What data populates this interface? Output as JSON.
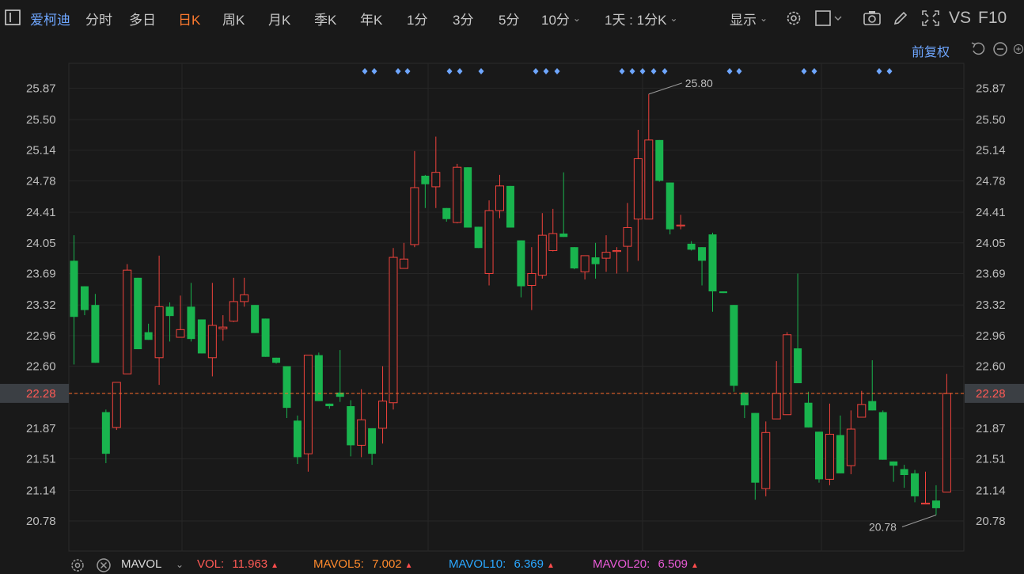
{
  "toolbar": {
    "stock_name": "爱柯迪",
    "periods": [
      "分时",
      "多日",
      "日K",
      "周K",
      "月K",
      "季K",
      "年K",
      "1分",
      "3分",
      "5分",
      "10分"
    ],
    "active_period": "日K",
    "interval_select": "1天 : 1分K",
    "display_label": "显示",
    "vs_label": "VS",
    "f10_label": "F10"
  },
  "adjust_label": "前复权",
  "axis": {
    "ticks": [
      "25.87",
      "25.50",
      "25.14",
      "24.78",
      "24.41",
      "24.05",
      "23.69",
      "23.32",
      "22.96",
      "22.60",
      "22.28",
      "21.87",
      "21.51",
      "21.14",
      "20.78"
    ],
    "current_price": "22.28"
  },
  "annotations": {
    "high": "25.80",
    "low": "20.78"
  },
  "volume": {
    "indicator": "MAVOL",
    "vol_label": "VOL:",
    "vol_value": "11.963",
    "mavol5_label": "MAVOL5:",
    "mavol5_value": "7.002",
    "mavol10_label": "MAVOL10:",
    "mavol10_value": "6.369",
    "mavol20_label": "MAVOL20:",
    "mavol20_value": "6.509"
  },
  "colors": {
    "up": "#f0423c",
    "down": "#19b44e",
    "accent": "#6ea6ff",
    "active": "#ff7a2e",
    "mavol5": "#ff8a2c",
    "mavol10": "#2aa7ff",
    "mavol20": "#e85ad6"
  },
  "chart_data": {
    "type": "candlestick",
    "ylim": [
      20.6,
      26.2
    ],
    "candles": [
      [
        23.84,
        23.18,
        24.14,
        22.62
      ],
      [
        23.54,
        23.26,
        23.54,
        23.2
      ],
      [
        23.32,
        22.64,
        23.45,
        22.64
      ],
      [
        22.06,
        21.57,
        22.09,
        21.46
      ],
      [
        21.88,
        22.41,
        22.41,
        21.85
      ],
      [
        22.51,
        23.73,
        23.8,
        22.51
      ],
      [
        23.64,
        22.8,
        23.64,
        22.8
      ],
      [
        23.0,
        22.91,
        23.1,
        22.91
      ],
      [
        22.7,
        23.3,
        23.9,
        22.38
      ],
      [
        23.3,
        23.19,
        23.35,
        22.89
      ],
      [
        22.94,
        23.03,
        23.43,
        22.94
      ],
      [
        23.3,
        22.92,
        23.58,
        22.89
      ],
      [
        23.15,
        22.75,
        23.15,
        22.75
      ],
      [
        22.7,
        23.08,
        23.58,
        22.48
      ],
      [
        23.04,
        23.06,
        23.2,
        22.9
      ],
      [
        23.13,
        23.36,
        23.64,
        23.12
      ],
      [
        23.36,
        23.44,
        23.64,
        23.3
      ],
      [
        23.32,
        22.99,
        23.32,
        22.99
      ],
      [
        23.16,
        22.71,
        23.16,
        22.71
      ],
      [
        22.7,
        22.64,
        22.7,
        22.63
      ],
      [
        22.6,
        22.11,
        22.6,
        21.99
      ],
      [
        21.96,
        21.53,
        22.02,
        21.45
      ],
      [
        21.57,
        22.73,
        22.73,
        21.36
      ],
      [
        22.73,
        22.19,
        22.76,
        22.19
      ],
      [
        22.16,
        22.13,
        22.16,
        22.1
      ],
      [
        22.29,
        22.24,
        22.79,
        22.18
      ],
      [
        22.13,
        21.67,
        22.2,
        21.54
      ],
      [
        21.67,
        21.97,
        22.33,
        21.53
      ],
      [
        21.87,
        21.57,
        21.87,
        21.44
      ],
      [
        21.87,
        22.19,
        22.6,
        21.69
      ],
      [
        22.17,
        23.88,
        23.99,
        22.09
      ],
      [
        23.75,
        23.86,
        24.05,
        23.75
      ],
      [
        24.03,
        24.7,
        25.13,
        24.0
      ],
      [
        24.84,
        24.74,
        24.85,
        24.46
      ],
      [
        24.71,
        24.88,
        25.3,
        24.46
      ],
      [
        24.46,
        24.33,
        24.46,
        24.3
      ],
      [
        24.29,
        24.94,
        24.98,
        24.28
      ],
      [
        24.94,
        24.23,
        24.94,
        24.23
      ],
      [
        24.24,
        23.99,
        24.24,
        23.99
      ],
      [
        23.69,
        24.43,
        24.55,
        23.55
      ],
      [
        24.43,
        24.72,
        24.85,
        24.34
      ],
      [
        24.72,
        24.23,
        24.72,
        24.23
      ],
      [
        24.08,
        23.54,
        24.08,
        23.41
      ],
      [
        23.55,
        23.69,
        24.0,
        23.26
      ],
      [
        23.67,
        24.14,
        24.4,
        23.63
      ],
      [
        23.96,
        24.16,
        24.45,
        23.95
      ],
      [
        24.16,
        24.12,
        24.88,
        24.12
      ],
      [
        24.0,
        23.75,
        24.0,
        23.74
      ],
      [
        23.71,
        23.9,
        23.9,
        23.62
      ],
      [
        23.88,
        23.8,
        24.05,
        23.63
      ],
      [
        23.87,
        23.94,
        24.14,
        23.71
      ],
      [
        23.96,
        23.96,
        24.0,
        23.69
      ],
      [
        24.01,
        24.23,
        24.52,
        23.71
      ],
      [
        24.33,
        25.04,
        25.38,
        23.84
      ],
      [
        24.33,
        25.26,
        25.8,
        24.33
      ],
      [
        25.26,
        24.78,
        25.26,
        24.77
      ],
      [
        24.76,
        24.21,
        24.76,
        24.15
      ],
      [
        24.26,
        24.26,
        24.38,
        24.21
      ],
      [
        24.04,
        23.97,
        24.07,
        23.96
      ],
      [
        24.0,
        23.84,
        24.0,
        23.55
      ],
      [
        24.15,
        23.48,
        24.17,
        23.24
      ],
      [
        23.48,
        23.46,
        23.48,
        23.46
      ],
      [
        23.32,
        22.37,
        23.32,
        22.3
      ],
      [
        22.29,
        22.14,
        22.29,
        21.99
      ],
      [
        22.05,
        21.23,
        22.05,
        21.03
      ],
      [
        21.16,
        21.82,
        21.95,
        21.07
      ],
      [
        21.98,
        22.28,
        22.66,
        22.05
      ],
      [
        22.03,
        22.97,
        23.0,
        22.03
      ],
      [
        22.81,
        22.4,
        23.69,
        22.4
      ],
      [
        22.17,
        21.88,
        22.3,
        21.88
      ],
      [
        21.83,
        21.27,
        21.83,
        21.23
      ],
      [
        21.27,
        21.8,
        22.16,
        21.2
      ],
      [
        21.79,
        21.34,
        22.02,
        21.34
      ],
      [
        21.43,
        21.86,
        22.08,
        21.33
      ],
      [
        22.0,
        22.15,
        22.31,
        22.0
      ],
      [
        22.19,
        22.08,
        22.67,
        22.08
      ],
      [
        22.06,
        21.5,
        22.08,
        21.5
      ],
      [
        21.48,
        21.43,
        21.48,
        21.24
      ],
      [
        21.39,
        21.32,
        21.44,
        21.17
      ],
      [
        21.34,
        21.07,
        21.38,
        21.0
      ],
      [
        20.98,
        20.99,
        21.36,
        20.98
      ],
      [
        21.02,
        20.93,
        21.2,
        20.85
      ],
      [
        21.12,
        22.28,
        22.51,
        21.12
      ]
    ],
    "markers_candle_index": [
      28,
      30,
      32,
      34,
      36,
      38,
      40,
      42,
      44,
      46,
      48,
      50,
      52,
      54,
      56,
      58,
      60,
      62,
      64,
      66,
      68,
      70,
      72,
      74
    ]
  }
}
